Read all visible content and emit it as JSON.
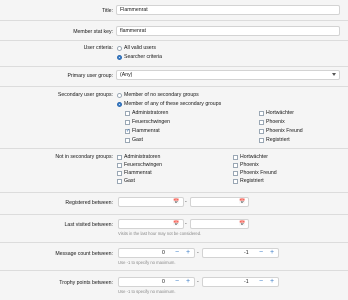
{
  "title": {
    "label": "Title:",
    "value": "Flammenrat"
  },
  "member_stat_key": {
    "label": "Member stat key:",
    "value": "flammenrat"
  },
  "user_criteria": {
    "label": "User criteria:",
    "opt_all": "All valid users",
    "opt_search": "Searcher criteria",
    "selected": "search"
  },
  "primary_group": {
    "label": "Primary user group:",
    "value": "(Any)"
  },
  "secondary_groups": {
    "label": "Secondary user groups:",
    "opt_none": "Member of no secondary groups",
    "opt_any": "Member of any of these secondary groups",
    "selected": "any",
    "groups": [
      {
        "name": "Administratoren",
        "checked": false
      },
      {
        "name": "Hortwächter",
        "checked": false
      },
      {
        "name": "Feuerschwingen",
        "checked": false
      },
      {
        "name": "Phoenix",
        "checked": false
      },
      {
        "name": "Flammenrat",
        "checked": true
      },
      {
        "name": "Phoenix Freund",
        "checked": false
      },
      {
        "name": "Gast",
        "checked": false
      },
      {
        "name": "Registriert",
        "checked": false
      }
    ]
  },
  "not_secondary": {
    "label": "Not in secondary groups:",
    "groups": [
      "Administratoren",
      "Hortwächter",
      "Feuerschwingen",
      "Phoenix",
      "Flammenrat",
      "Phoenix Freund",
      "Gast",
      "Registriert"
    ]
  },
  "registered_between": {
    "label": "Registered between:",
    "sep": "-"
  },
  "last_visited_between": {
    "label": "Last visited between:",
    "sep": "-",
    "hint": "Visits in the last hour may not be considered."
  },
  "message_count": {
    "label": "Message count between:",
    "min": "0",
    "max": "-1",
    "sep": "-",
    "hint": "Use -1 to specify no maximum.",
    "minus": "−",
    "plus": "+"
  },
  "trophy_points": {
    "label": "Trophy points between:",
    "min": "0",
    "max": "-1",
    "sep": "-",
    "hint": "Use -1 to specify no maximum.",
    "minus": "−",
    "plus": "+"
  },
  "colors": {
    "accent": "#3c7ec7",
    "bg": "#f5f5f5",
    "border": "#d3d3d3"
  },
  "icons": {
    "calendar": "calendar-icon"
  }
}
